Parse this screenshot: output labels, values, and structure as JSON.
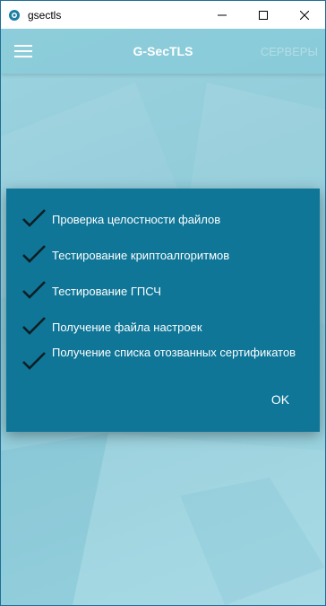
{
  "window": {
    "title": "gsectls"
  },
  "appbar": {
    "title": "G-SecTLS",
    "servers_label": "СЕРВЕРЫ"
  },
  "dialog": {
    "items": [
      {
        "label": "Проверка целостности файлов",
        "checked": true
      },
      {
        "label": "Тестирование криптоалгоритмов",
        "checked": true
      },
      {
        "label": "Тестирование ГПСЧ",
        "checked": true
      },
      {
        "label": "Получение файла настроек",
        "checked": true
      },
      {
        "label": "Получение списка отозванных сертификатов",
        "checked": true
      }
    ],
    "ok_label": "OK"
  },
  "colors": {
    "dialog_bg": "#0f7698",
    "page_bg": "#9fd5e2"
  }
}
